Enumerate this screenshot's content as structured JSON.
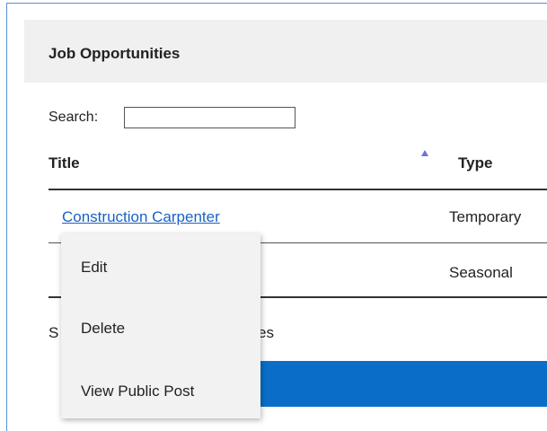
{
  "panel": {
    "title": "Job Opportunities"
  },
  "search": {
    "label": "Search:",
    "value": ""
  },
  "table": {
    "columns": [
      {
        "label": "Title",
        "sort": "ascending"
      },
      {
        "label": "Type"
      }
    ],
    "rows": [
      {
        "title": "Construction Carpenter",
        "type": "Temporary"
      },
      {
        "title": "",
        "type": "Seasonal"
      }
    ],
    "info_prefix": "S",
    "info_suffix": "es"
  },
  "context_menu": {
    "items": [
      {
        "label": "Edit"
      },
      {
        "label": "Delete"
      },
      {
        "label": "View Public Post"
      }
    ]
  },
  "colors": {
    "link": "#1a62c5",
    "accent_bar": "#0a6ec8",
    "header_bg": "#f0f0f0",
    "sort_arrow": "#6f6fdd"
  }
}
